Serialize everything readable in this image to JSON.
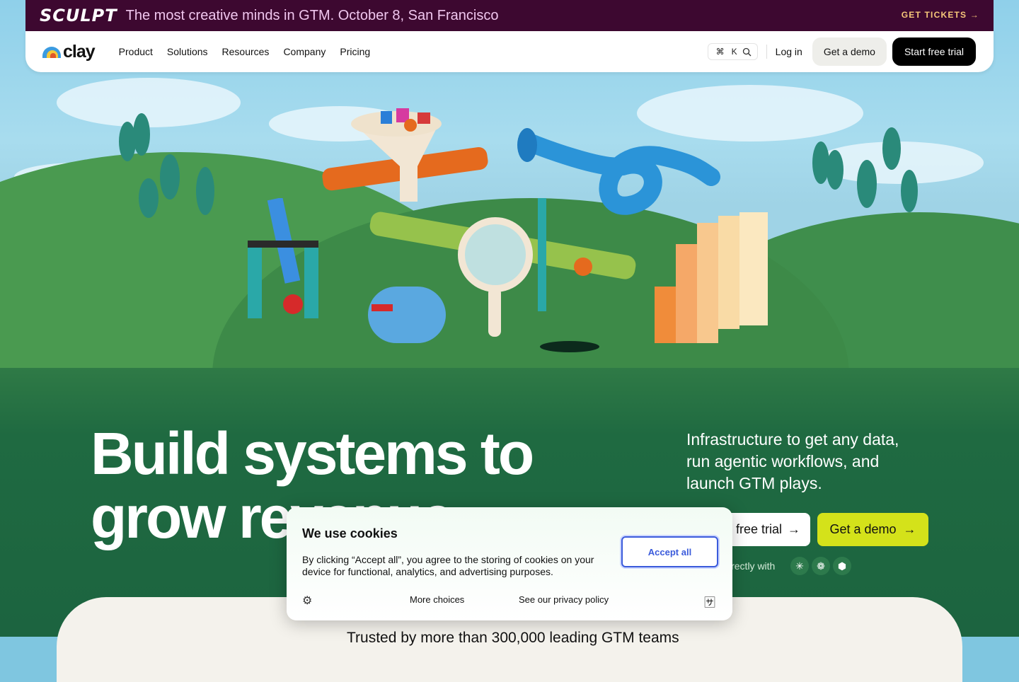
{
  "banner": {
    "logo_text": "SCULPT",
    "text": "The most creative minds in GTM. October 8, San Francisco",
    "cta": "GET TICKETS →"
  },
  "nav": {
    "logo_text": "clay",
    "menu": [
      "Product",
      "Solutions",
      "Resources",
      "Company",
      "Pricing"
    ],
    "shortcut_cmd": "⌘",
    "shortcut_key": "K",
    "login": "Log in",
    "demo": "Get a demo",
    "trial": "Start free trial"
  },
  "hero": {
    "headline_line1": "Build systems to",
    "headline_line2": "grow revenue",
    "subtext": "Infrastructure to get any data, run agentic workflows, and launch GTM plays.",
    "cta_trial": "free trial",
    "cta_demo": "Get a demo",
    "integrations_text": "irectly with",
    "integration_icons": [
      "anthropic-icon",
      "openai-icon",
      "cube-icon"
    ]
  },
  "trusted": {
    "text": "Trusted by more than 300,000 leading GTM teams"
  },
  "cookie": {
    "title": "We use cookies",
    "body": "By clicking “Accept all”, you agree to the storing of cookies on your device for functional, analytics, and advertising purposes.",
    "accept": "Accept all",
    "more_choices": "More choices",
    "privacy": "See our privacy policy"
  },
  "colors": {
    "banner_bg": "#3d0830",
    "accent_demo": "#d4e21a",
    "hero_green": "#1f6a41",
    "accept_blue": "#3b5bdb"
  }
}
